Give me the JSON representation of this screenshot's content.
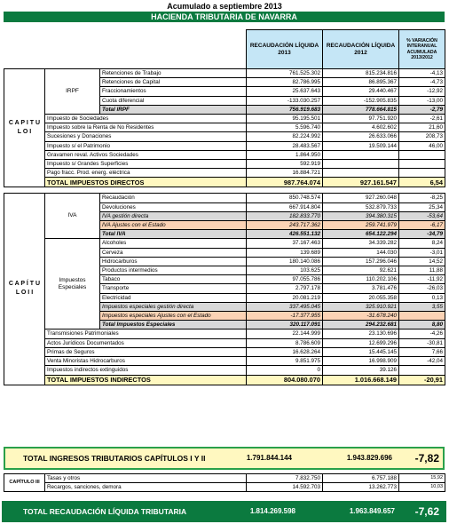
{
  "title": "Acumulado a septiembre 2013",
  "banner": "HACIENDA TRIBUTARIA DE NAVARRA",
  "headers": {
    "col2013": "RECAUDACIÓN LÍQUIDA 2013",
    "col2012": "RECAUDACIÓN LÍQUIDA 2012",
    "colvar": "% VARIACIÓN INTERANUAL ACUMULADA 2013/2012"
  },
  "cap1": {
    "label": "C A P I T U L O   I",
    "irpf_label": "IRPF",
    "irpf_rows": [
      {
        "label": "Retenciones de Trabajo",
        "v2013": "761.525.302",
        "v2012": "815.234.816",
        "var": "-4,13"
      },
      {
        "label": "Retenciones de Capital",
        "v2013": "82.786.995",
        "v2012": "86.895.367",
        "var": "-4,73"
      },
      {
        "label": "Fraccionamientos",
        "v2013": "25.637.643",
        "v2012": "29.440.467",
        "var": "-12,92"
      },
      {
        "label": "Cuota diferencial",
        "v2013": "-133.030.257",
        "v2012": "-152.905.835",
        "var": "-13,00"
      }
    ],
    "irpf_total": {
      "label": "Total IRPF",
      "v2013": "756.919.683",
      "v2012": "778.664.815",
      "var": "-2,79"
    },
    "rows": [
      {
        "label": "Impuesto de Sociedades",
        "v2013": "95.195.501",
        "v2012": "97.751.920",
        "var": "-2,61"
      },
      {
        "label": "Impuesto sobre la Renta de No Residentes",
        "v2013": "5.596.740",
        "v2012": "4.602.602",
        "var": "21,60"
      },
      {
        "label": "Sucesiones y Donaciones",
        "v2013": "82.224.992",
        "v2012": "26.633.066",
        "var": "208,73"
      },
      {
        "label": "Impuesto s/ el Patrimonio",
        "v2013": "28.483.567",
        "v2012": "19.509.144",
        "var": "46,00"
      },
      {
        "label": "Gravamen reval. Activos Sociedades",
        "v2013": "1.864.950",
        "v2012": "",
        "var": ""
      },
      {
        "label": "Impuesto s/ Grandes Superficies",
        "v2013": "592.919",
        "v2012": "",
        "var": ""
      },
      {
        "label": "Pago fracc. Prod. energ. eléctrica",
        "v2013": "16.884.721",
        "v2012": "",
        "var": ""
      }
    ],
    "total": {
      "label": "TOTAL IMPUESTOS DIRECTOS",
      "v2013": "987.764.074",
      "v2012": "927.161.547",
      "var": "6,54"
    }
  },
  "cap2": {
    "label": "C A P Í T U L O   I I",
    "iva_label": "IVA",
    "iva_rows": [
      {
        "label": "Recaudación",
        "v2013": "850.748.574",
        "v2012": "927.260.048",
        "var": "-8,25",
        "style": ""
      },
      {
        "label": "Devoluciones",
        "v2013": "667.914.804",
        "v2012": "532.879.733",
        "var": "25,34",
        "style": ""
      },
      {
        "label": "IVA gestión directa",
        "v2013": "182.833.770",
        "v2012": "394.380.315",
        "var": "-53,64",
        "style": "gray"
      },
      {
        "label": "IVA Ajustes con el Estado",
        "v2013": "243.717.362",
        "v2012": "259.741.979",
        "var": "-6,17",
        "style": "orange"
      }
    ],
    "iva_total": {
      "label": "Total IVA",
      "v2013": "426.551.132",
      "v2012": "654.122.294",
      "var": "-34,79"
    },
    "ie_label": "Impuestos Especiales",
    "ie_rows": [
      {
        "label": "Alcoholes",
        "v2013": "37.167.463",
        "v2012": "34.339.282",
        "var": "8,24",
        "style": ""
      },
      {
        "label": "Cerveza",
        "v2013": "139.689",
        "v2012": "144.030",
        "var": "-3,01",
        "style": ""
      },
      {
        "label": "Hidrocarburos",
        "v2013": "180.140.086",
        "v2012": "157.296.046",
        "var": "14,52",
        "style": ""
      },
      {
        "label": "Productos intermedios",
        "v2013": "103.625",
        "v2012": "92.621",
        "var": "11,88",
        "style": ""
      },
      {
        "label": "Tabaco",
        "v2013": "97.055.786",
        "v2012": "110.202.106",
        "var": "-11,92",
        "style": ""
      },
      {
        "label": "Transporte",
        "v2013": "2.797.178",
        "v2012": "3.781.476",
        "var": "-26,03",
        "style": ""
      },
      {
        "label": "Electricidad",
        "v2013": "20.081.219",
        "v2012": "20.055.358",
        "var": "0,13",
        "style": ""
      },
      {
        "label": "Impuestos especiales gestión directa",
        "v2013": "337.495.045",
        "v2012": "325.910.921",
        "var": "3,55",
        "style": "gray"
      },
      {
        "label": "Impuestos especiales Ajustes con el Estado",
        "v2013": "-17.377.955",
        "v2012": "-31.678.240",
        "var": "",
        "style": "orange"
      }
    ],
    "ie_total": {
      "label": "Total Impuestos Especiales",
      "v2013": "320.117.091",
      "v2012": "294.232.681",
      "var": "8,80"
    },
    "rows": [
      {
        "label": "Transmisiones Patrimoniales",
        "v2013": "22.144.999",
        "v2012": "23.130.696",
        "var": "-4,26"
      },
      {
        "label": "Actos Jurídicos Documentados",
        "v2013": "8.786.609",
        "v2012": "12.699.296",
        "var": "-30,81"
      },
      {
        "label": "Primas de Seguros",
        "v2013": "16.628.264",
        "v2012": "15.445.145",
        "var": "7,66"
      },
      {
        "label": "Venta Minoristas Hidrocarburos",
        "v2013": "9.851.975",
        "v2012": "16.998.909",
        "var": "-42,04"
      },
      {
        "label": "Impuestos indirectos extinguidos",
        "v2013": "0",
        "v2012": "39.126",
        "var": ""
      }
    ],
    "total": {
      "label": "TOTAL IMPUESTOS INDIRECTOS",
      "v2013": "804.080.070",
      "v2012": "1.016.668.149",
      "var": "-20,91"
    }
  },
  "grand": {
    "label": "TOTAL INGRESOS TRIBUTARIOS CAPÍTULOS I Y II",
    "v2013": "1.791.844.144",
    "v2012": "1.943.829.696",
    "var": "-7,82"
  },
  "cap3": {
    "label": "CAPÍTULO III",
    "rows": [
      {
        "label": "Tasas y otros",
        "v2013": "7.832.750",
        "v2012": "6.757.188",
        "var": "15,92"
      },
      {
        "label": "Recargos, sanciones, demora",
        "v2013": "14.592.703",
        "v2012": "13.262.773",
        "var": "10,03"
      }
    ]
  },
  "final": {
    "label": "TOTAL RECAUDACIÓN LÍQUIDA TRIBUTARIA",
    "v2013": "1.814.269.598",
    "v2012": "1.963.849.657",
    "var": "-7,62"
  },
  "colors": {
    "green": "#0b7a3f",
    "header_blue": "#c5e6f6",
    "total_yellow": "#fff8c0",
    "gray": "#d9d9d9",
    "orange": "#fbd3b5"
  }
}
